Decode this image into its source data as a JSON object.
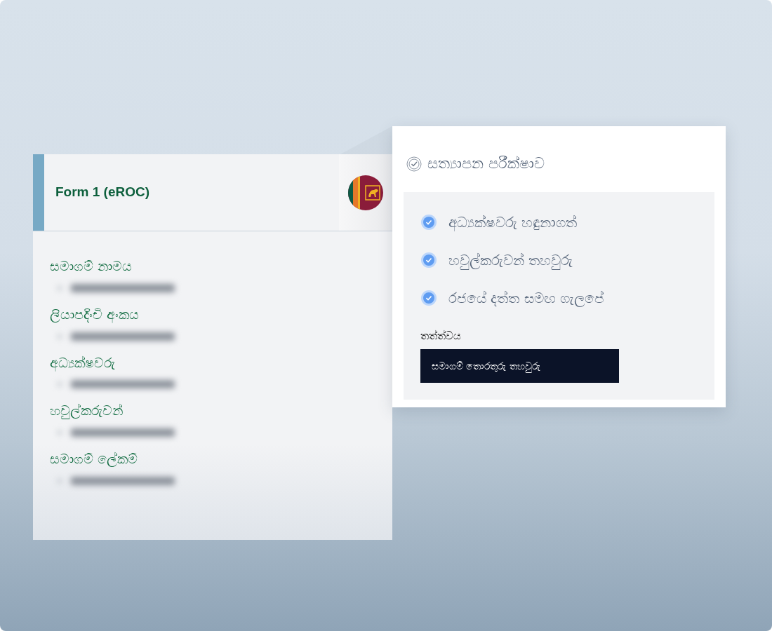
{
  "form_card": {
    "title": "Form 1 (eROC)",
    "sections": [
      {
        "label": "සමාගම් නාමය"
      },
      {
        "label": "ලියාපදිංචි අංකය"
      },
      {
        "label": "අධ්‍යක්ෂවරු"
      },
      {
        "label": "හවුල්කරුවන්"
      },
      {
        "label": "සමාගම් ලේකම්"
      }
    ]
  },
  "verification_card": {
    "title": "සත්‍යාපන පරීක්ෂාව",
    "checks": [
      {
        "label": "අධ්‍යක්ෂවරු හඳුනාගත්",
        "checked": true
      },
      {
        "label": "හවුල්කරුවන් තහවුරු",
        "checked": true
      },
      {
        "label": "රජයේ දත්ත සමඟ ගැලපේ",
        "checked": true
      }
    ],
    "status_label": "තත්ත්වය",
    "status_value": "සමාගම් තොරතුරු තහවුරු"
  }
}
